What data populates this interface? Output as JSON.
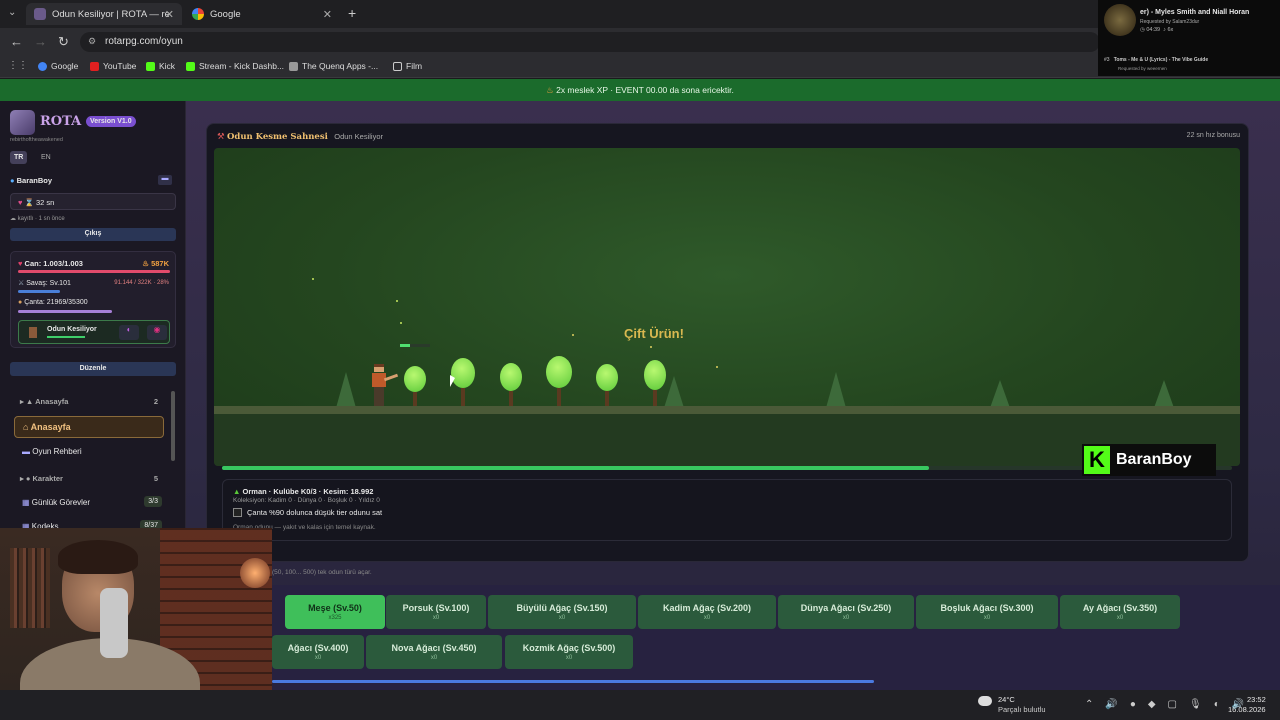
{
  "browser": {
    "tabs": [
      {
        "title": "Odun Kesiliyor | ROTA — re"
      },
      {
        "title": "Google"
      }
    ],
    "url": "rotarpg.com/oyun",
    "bookmarks": [
      "Google",
      "YouTube",
      "Kick",
      "Stream - Kick Dashb...",
      "The Quenq Apps -...",
      "Film"
    ]
  },
  "music_overlay": {
    "now_playing": "er) - Myles Smith and Niall Horan",
    "requested_by": "Requested by Salam23dur",
    "time": "04:39",
    "count": "6x",
    "next_num": "#3",
    "next_title": "Toms - Me & U (Lyrics) - The Vibe Guide",
    "next_requested": "Requested by weeernen"
  },
  "event": {
    "text": "2x meslek XP · EVENT 00.00 da sona ericektir."
  },
  "sidebar": {
    "brand": "ROTA",
    "version": "Version V1.0",
    "subtitle": "rebirthoftheawakened",
    "lang_tr": "TR",
    "lang_en": "EN",
    "username": "BaranBoy",
    "timer": "32 sn",
    "saved": "kayıtlı · 1 sn önce",
    "logout": "Çıkış",
    "hp": "Can: 1.003/1.003",
    "gold": "587K",
    "combat": "Savaş: Sv.101",
    "combat_xp": "91.144 / 322K · 28%",
    "bag": "Çanta: 21969/35300",
    "activity": "Odun Kesiliyor",
    "edit": "Düzenle",
    "nav": [
      {
        "group": "Anasayfa",
        "count": "2"
      },
      {
        "item": "Anasayfa"
      },
      {
        "item": "Oyun Rehberi"
      },
      {
        "group": "Karakter",
        "count": "5"
      },
      {
        "item": "Günlük Görevler",
        "badge": "3/3"
      },
      {
        "item": "Kodeks",
        "badge": "8/37"
      }
    ]
  },
  "panel": {
    "title": "Odun Kesme Sahnesi",
    "subtitle": "Odun Kesiliyor",
    "bonus": "22 sn hız bonusu",
    "floating_text": "Çift Ürün!",
    "progress": 0.7
  },
  "info": {
    "line1": "Orman · Kulübe K0/3 · Kesim: 18.992",
    "line2": "Koleksiyon: Kadim 0 · Dünya 0 · Boşluk 0 · Yıldız 0",
    "checkbox": "Çanta %90 dolunca düşük tier odunu sat",
    "desc": "Orman odunu — yakıt ve kalas için temel kaynak.",
    "hint": "(50, 100... 500) tek odun türü açar."
  },
  "trees": [
    {
      "label": "Meşe (Sv.50)",
      "sub": "x325",
      "active": true
    },
    {
      "label": "Porsuk (Sv.100)",
      "sub": "x0"
    },
    {
      "label": "Büyülü Ağaç (Sv.150)",
      "sub": "x0"
    },
    {
      "label": "Kadim Ağaç (Sv.200)",
      "sub": "x0"
    },
    {
      "label": "Dünya Ağacı (Sv.250)",
      "sub": "x0"
    },
    {
      "label": "Boşluk Ağacı (Sv.300)",
      "sub": "x0"
    },
    {
      "label": "Ay Ağacı (Sv.350)",
      "sub": "x0"
    },
    {
      "label": "Ağacı (Sv.400)",
      "sub": "x0"
    },
    {
      "label": "Nova Ağacı (Sv.450)",
      "sub": "x0"
    },
    {
      "label": "Kozmik Ağaç (Sv.500)",
      "sub": "x0"
    }
  ],
  "streamer_tag": "BaranBoy",
  "taskbar": {
    "temp": "24°C",
    "weather": "Parçalı bulutlu",
    "time": "23:52",
    "date": "16.08.2026"
  }
}
